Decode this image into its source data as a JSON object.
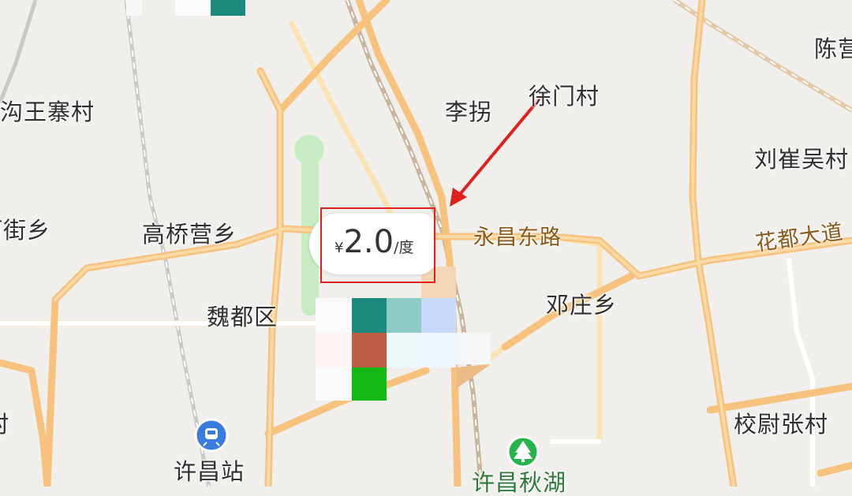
{
  "places": {
    "chen": "陈营",
    "xumen": "徐门村",
    "lishou": "李拐",
    "gouwang": "沟王寨村",
    "liucui": "刘崔吴村",
    "jiexiang": "河街乡",
    "gaoqiao": "高桥营乡",
    "weidu": "魏都区",
    "dengzhuang": "邓庄乡",
    "xiaowei": "校尉张村",
    "station": "许昌站",
    "qiuhu": "许昌秋湖"
  },
  "roads": {
    "yongchang": "永昌东路",
    "huadu": "花都大道"
  },
  "price": {
    "currency": "¥",
    "value": "2.0",
    "unit": "/度"
  },
  "colors": {
    "arrow": "#e0201d",
    "box": "#e0201d",
    "road_major": "#f6c27e",
    "road_minor": "#fbe3b4",
    "park": "#c7ecc2",
    "station_icon": "#3a7be0",
    "park_icon": "#27b34b"
  },
  "icons": [
    "train-station-icon",
    "park-tree-icon"
  ]
}
